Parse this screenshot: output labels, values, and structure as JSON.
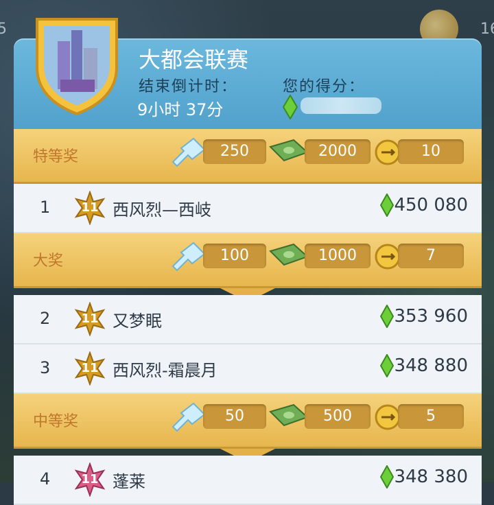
{
  "header": {
    "title": "大都会联赛",
    "countdown_label": "结束倒计时：",
    "countdown_value": "9小时 37分",
    "score_label": "您的得分："
  },
  "background": {
    "left_num": "5",
    "right_num": "16"
  },
  "tiers": [
    {
      "name": "特等奖",
      "key": "250",
      "cash": "2000",
      "gold": "10"
    },
    {
      "name": "大奖",
      "key": "100",
      "cash": "1000",
      "gold": "7"
    },
    {
      "name": "中等奖",
      "key": "50",
      "cash": "500",
      "gold": "5"
    }
  ],
  "players": [
    {
      "rank": "1",
      "level": "11",
      "name": "西风烈—西岐",
      "score": "450 080"
    },
    {
      "rank": "2",
      "level": "11",
      "name": "又梦眠",
      "score": "353 960"
    },
    {
      "rank": "3",
      "level": "11",
      "name": "西风烈-霜晨月",
      "score": "348 880"
    },
    {
      "rank": "4",
      "level": "11",
      "name": "蓬莱",
      "score": "348 380"
    }
  ],
  "icons": [
    "city-shield-icon",
    "simoleon-gem-icon",
    "key-icon",
    "cash-icon",
    "gold-key-icon",
    "level-star-icon"
  ]
}
